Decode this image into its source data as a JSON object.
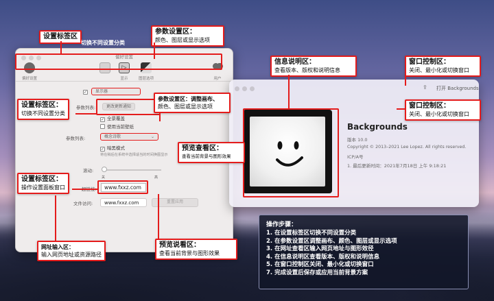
{
  "settings_window": {
    "title": "偏好设置",
    "toolbar": [
      {
        "label": "偏好设置",
        "icon": "gear-icon"
      },
      {
        "label": "",
        "icon": "panel-icon"
      },
      {
        "label": "显示",
        "icon": "display-icon"
      },
      {
        "label": "图层选项",
        "icon": "layers-icon"
      },
      {
        "label": "用户",
        "icon": "users-icon"
      }
    ],
    "checkbox_top": "✓",
    "dropdown_top": "显示器",
    "param_list_label": "参数列表:",
    "param_list_button": "更改更新通知",
    "checkbox_all": "全景覆盖",
    "checkbox_desktop": "使用当前壁纸",
    "param_row_label": "参数列表:",
    "param_row_select": "概念诗歌",
    "checkbox_dark": "暗黑模式",
    "tiny_note": "将在稍后在系统中选择适当的时间换图显示",
    "slider_label": "滚动:",
    "slider_min": "关",
    "slider_max": "高",
    "url_label": "超链接:",
    "url_value": "www.fxxz.com",
    "file_label": "文件访问:",
    "file_value": "www.fxxz.com",
    "file_button": "重置应用"
  },
  "about_window": {
    "open_label": "打开 Backgrounds",
    "app_name": "Backgrounds",
    "version": "版本 10.0",
    "copyright": "Copyright © 2013–2021 Lee Lopez. All rights reserved.",
    "extra": "ICP/A号",
    "updated": "1. 最后更新时间：2021年7月18日 上午 9:18:21"
  },
  "annotations": {
    "tab_area_top": {
      "title": "设置标签区",
      "sub": "切换不同设置分类"
    },
    "param_area_top": {
      "title": "参数设置区：",
      "sub1": "颜色、图层或显示选项"
    },
    "tab_area_mid": {
      "title": "设置标签区：",
      "sub": "切换不同设置分类"
    },
    "param_area_mid": {
      "title": "参数设置区：调整画布、",
      "sub": "颜色、图层或显示选项"
    },
    "preview_mid": {
      "title": "预览查看区：",
      "sub": "查看当前背景与图形效果"
    },
    "tab_area_low": {
      "title": "设置标签区：",
      "sub": "操作设置面板窗口"
    },
    "url_area": {
      "title": "网址输入区：",
      "sub": "输入网页地址或资源路径"
    },
    "preview_bottom": {
      "title": "预览说看区：",
      "sub": "查看当前背景与图形效果"
    },
    "info_area": {
      "title": "信息说明区：",
      "sub": "查看版本、版权和说明信息"
    },
    "window_ctrl_1": {
      "title": "窗口控制区：",
      "sub": "关闭、最小化或切换窗口"
    },
    "window_ctrl_2": {
      "title": "窗口控制区：",
      "sub": "关闭、最小化或切换窗口"
    }
  },
  "steps": {
    "heading": "操作步骤：",
    "items": [
      "1. 在设置标签区切换不同设置分类",
      "2. 在参数设置区调整画布、颜色、图层或显示选项",
      "3. 在网址查看区输入网页地址与图形效径",
      "4. 在信息说明区查看版本、版权和说明信息",
      "5. 在窗口控制区关闭、最小化或切换窗口",
      "7. 完成设置后保存或应用当前背景方案"
    ]
  }
}
